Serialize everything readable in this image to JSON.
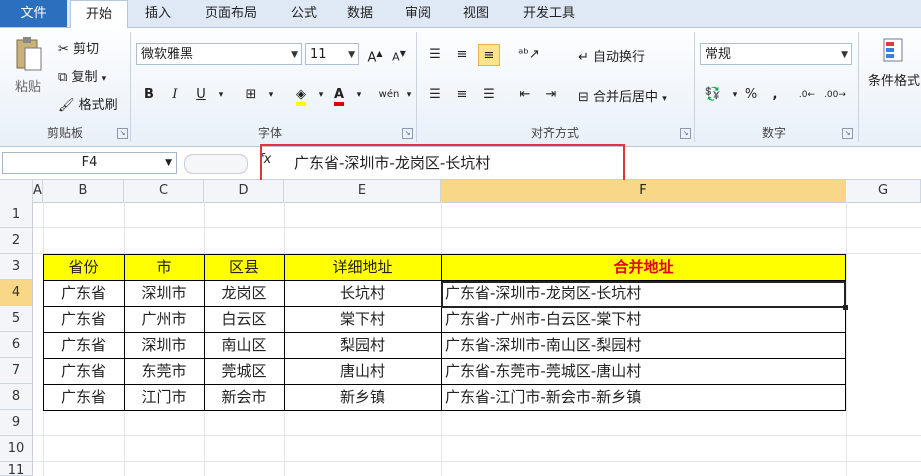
{
  "ribbon": {
    "tabs": [
      "文件",
      "开始",
      "插入",
      "页面布局",
      "公式",
      "数据",
      "审阅",
      "视图",
      "开发工具"
    ],
    "clipboard": {
      "paste": "粘贴",
      "cut": "剪切",
      "copy": "复制",
      "format_painter": "格式刷",
      "group": "剪贴板"
    },
    "font": {
      "name": "微软雅黑",
      "size": "11",
      "bold": "B",
      "italic": "I",
      "underline": "U",
      "group": "字体"
    },
    "alignment": {
      "wrap": "自动换行",
      "merge": "合并后居中",
      "group": "对齐方式"
    },
    "number": {
      "format": "常规",
      "percent": "%",
      "comma": ",",
      "group": "数字"
    },
    "styles": {
      "conditional": "条件格式"
    }
  },
  "formula_bar": {
    "name_box": "F4",
    "fx": "fx",
    "value": "广东省-深圳市-龙岗区-长坑村"
  },
  "grid": {
    "columns": [
      "A",
      "B",
      "C",
      "D",
      "E",
      "F",
      "G"
    ],
    "rows": [
      "1",
      "2",
      "3",
      "4",
      "5",
      "6",
      "7",
      "8",
      "9",
      "10",
      "11"
    ],
    "active_cell": "F4"
  },
  "table": {
    "headers": [
      "省份",
      "市",
      "区县",
      "详细地址",
      "合并地址"
    ],
    "rows": [
      [
        "广东省",
        "深圳市",
        "龙岗区",
        "长坑村",
        "广东省-深圳市-龙岗区-长坑村"
      ],
      [
        "广东省",
        "广州市",
        "白云区",
        "棠下村",
        "广东省-广州市-白云区-棠下村"
      ],
      [
        "广东省",
        "深圳市",
        "南山区",
        "梨园村",
        "广东省-深圳市-南山区-梨园村"
      ],
      [
        "广东省",
        "东莞市",
        "莞城区",
        "唐山村",
        "广东省-东莞市-莞城区-唐山村"
      ],
      [
        "广东省",
        "江门市",
        "新会市",
        "新乡镇",
        "广东省-江门市-新会市-新乡镇"
      ]
    ]
  },
  "colors": {
    "header_fill": "#ffff00",
    "merge_header_text": "#e3001b",
    "highlight_box": "#e0353a",
    "file_tab": "#2b6fbf"
  }
}
